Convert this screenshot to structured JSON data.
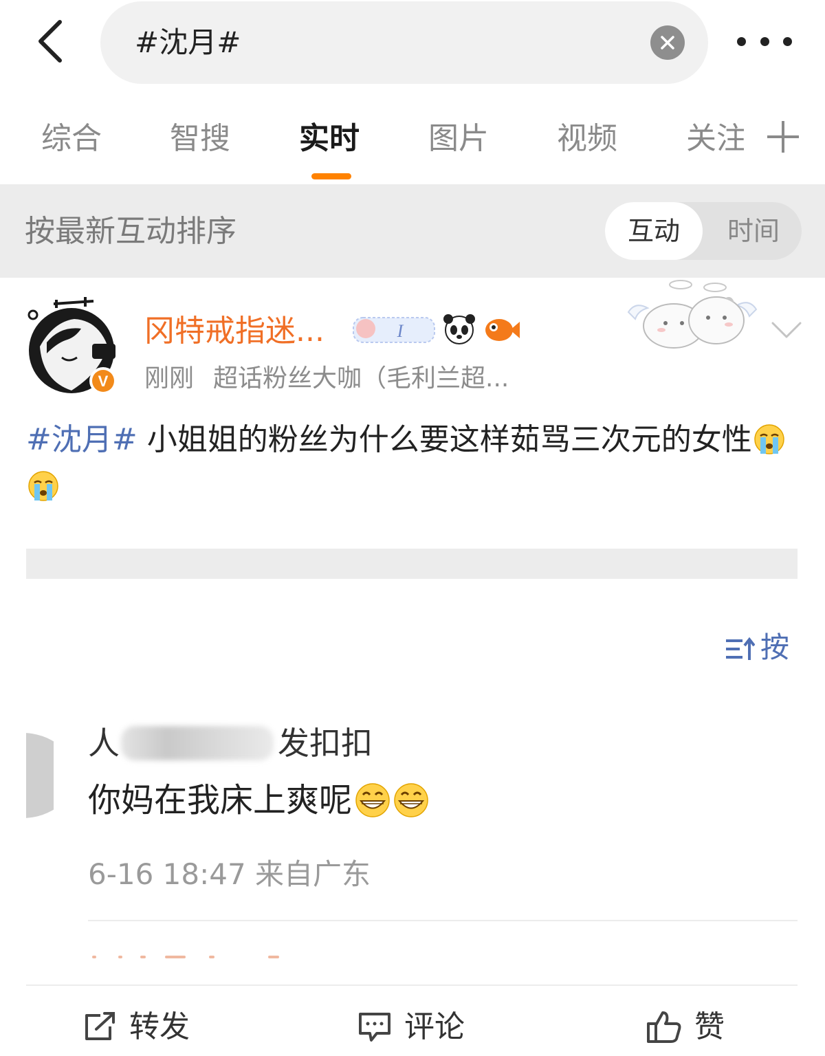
{
  "search": {
    "query": "#沈月#"
  },
  "tabs": [
    {
      "label": "综合"
    },
    {
      "label": "智搜"
    },
    {
      "label": "实时"
    },
    {
      "label": "图片"
    },
    {
      "label": "视频"
    },
    {
      "label": "关注"
    }
  ],
  "active_tab": "实时",
  "accent_color": "#ff8200",
  "sort": {
    "label": "按最新互动排序",
    "options": [
      "互动",
      "时间"
    ],
    "selected": "互动"
  },
  "post": {
    "author": "冈特戒指迷...",
    "time": "刚刚",
    "source": "超话粉丝大咖（毛利兰超...",
    "topic": "#沈月#",
    "text": " 小姐姐的粉丝为什么要这样茹骂三次元的女性",
    "emoji": "crying-face-icon"
  },
  "comments_sort_label": "按",
  "comment": {
    "name_start": "人",
    "name_end": "发扣扣",
    "text": "你妈在我床上爽呢",
    "emoji": "grinning-face-icon",
    "time": "6-16 18:47 来自广东"
  },
  "actions": {
    "repost": "转发",
    "comment": "评论",
    "like": "赞"
  },
  "colors": {
    "author_name": "#f06f26",
    "topic_link": "#4f6fb4"
  }
}
